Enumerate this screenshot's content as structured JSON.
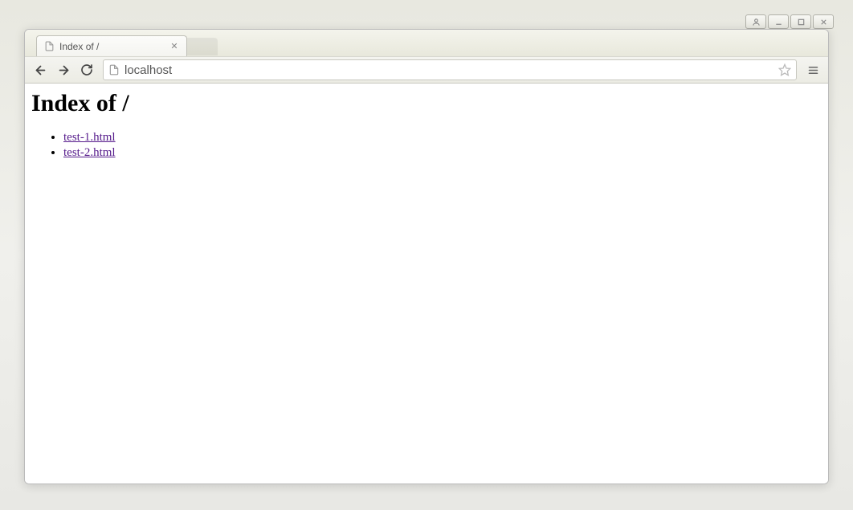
{
  "window": {
    "tab_title": "Index of /",
    "url": "localhost"
  },
  "page": {
    "heading": "Index of /",
    "files": [
      "test-1.html",
      "test-2.html"
    ]
  }
}
